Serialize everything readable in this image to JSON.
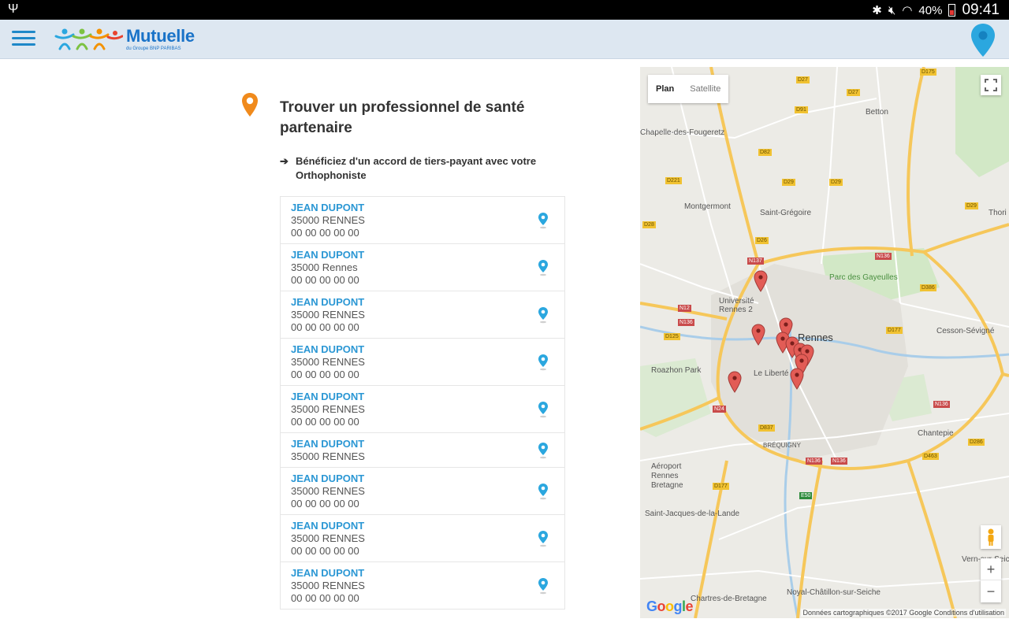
{
  "status_bar": {
    "battery": "40%",
    "time": "09:41"
  },
  "header": {
    "brand": "Mutuelle",
    "brand_sub": "du Groupe BNP PARIBAS"
  },
  "page": {
    "title": "Trouver un professionnel de santé partenaire",
    "subtitle": "Bénéficiez d'un accord de tiers-payant avec votre Orthophoniste"
  },
  "results": [
    {
      "name": "JEAN DUPONT",
      "city": "35000 RENNES",
      "phone": "00 00 00 00 00"
    },
    {
      "name": "JEAN DUPONT",
      "city": "35000 Rennes",
      "phone": "00 00 00 00 00"
    },
    {
      "name": "JEAN DUPONT",
      "city": "35000 RENNES",
      "phone": "00 00 00 00 00"
    },
    {
      "name": "JEAN DUPONT",
      "city": "35000 RENNES",
      "phone": "00 00 00 00 00"
    },
    {
      "name": "JEAN DUPONT",
      "city": "35000 RENNES",
      "phone": "00 00 00 00 00"
    },
    {
      "name": "JEAN DUPONT",
      "city": "35000 RENNES",
      "phone": ""
    },
    {
      "name": "JEAN DUPONT",
      "city": "35000 RENNES",
      "phone": "00 00 00 00 00"
    },
    {
      "name": "JEAN DUPONT",
      "city": "35000 RENNES",
      "phone": "00 00 00 00 00"
    },
    {
      "name": "JEAN DUPONT",
      "city": "35000 RENNES",
      "phone": "00 00 00 00 00"
    }
  ],
  "map": {
    "type_plan": "Plan",
    "type_satellite": "Satellite",
    "zoom_in": "+",
    "zoom_out": "−",
    "google": "Google",
    "attribution": "Données cartographiques ©2017 Google    Conditions d'utilisation",
    "labels": {
      "chapelle": "Chapelle-des-Fougeretz",
      "betton": "Betton",
      "montgermont": "Montgermont",
      "saint_gregoire": "Saint-Grégoire",
      "gayeulles": "Parc des Gayeulles",
      "universite": "Université Rennes 2",
      "rennes": "Rennes",
      "cesson": "Cesson-Sévigné",
      "roazhon": "Roazhon Park",
      "liberte": "Le Liberté",
      "aeroport": "Aéroport Rennes Bretagne",
      "saint_jacques": "Saint-Jacques-de-la-Lande",
      "chantepie": "Chantepie",
      "chartres": "Chartres-de-Bretagne",
      "noyal": "Noyal-Châtillon-sur-Seiche",
      "vern": "Vern-sur-Seiche",
      "brequigny": "BRÉQUIGNY",
      "thorigne": "Thori"
    },
    "shields": {
      "d27": "D27",
      "d29": "D29",
      "d175": "D175",
      "d82": "D82",
      "d91": "D91",
      "d221": "D221",
      "d26": "D26",
      "d28": "D28",
      "n137": "N137",
      "n136": "N136",
      "d386": "D386",
      "n12": "N12",
      "n24": "N24",
      "d125": "D125",
      "d837": "D837",
      "d177": "D177",
      "d463": "D463",
      "d286": "D286",
      "e50": "E50"
    },
    "colors": {
      "pin": "#e25c56",
      "road_major": "#f6c75a",
      "road_minor": "#ffffff",
      "park": "#c7e3b8",
      "water": "#a9cde9"
    }
  }
}
